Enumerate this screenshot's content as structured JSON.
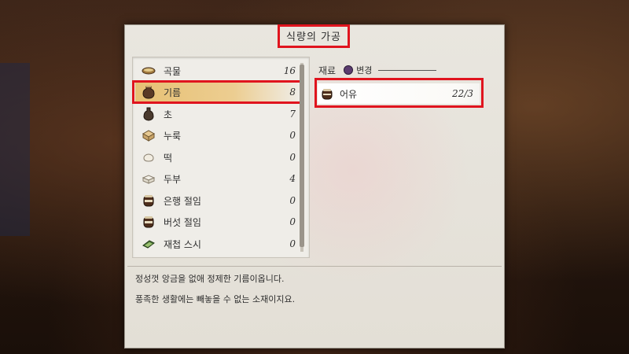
{
  "window_title": "식량의 가공",
  "ingredient_list": [
    {
      "label": "곡물",
      "count": "16",
      "icon": "grain-bowl-icon"
    },
    {
      "label": "기름",
      "count": "8",
      "icon": "oil-jar-icon",
      "selected": true
    },
    {
      "label": "초",
      "count": "7",
      "icon": "vinegar-jar-icon"
    },
    {
      "label": "누룩",
      "count": "0",
      "icon": "yeast-block-icon"
    },
    {
      "label": "떡",
      "count": "0",
      "icon": "rice-cake-icon"
    },
    {
      "label": "두부",
      "count": "4",
      "icon": "tofu-icon"
    },
    {
      "label": "은행 절임",
      "count": "0",
      "icon": "pickle-jar-icon"
    },
    {
      "label": "버섯 절임",
      "count": "0",
      "icon": "pickle-jar-icon"
    },
    {
      "label": "재첩 스시",
      "count": "0",
      "icon": "sushi-icon"
    }
  ],
  "materials": {
    "header": "재료",
    "change_label": "변경",
    "items": [
      {
        "label": "어유",
        "count": "22/3",
        "icon": "fish-oil-jar-icon"
      }
    ]
  },
  "description": {
    "line1": "정성껏 앙금을 없애 정제한 기름이옵니다.",
    "line2": "풍족한 생활에는 빼놓을 수 없는 소재이지요."
  },
  "colors": {
    "highlight": "#e0141e",
    "panel": "#e6e2da",
    "selected_row": "#e6be6e",
    "change_button": "#5b3b6e"
  }
}
